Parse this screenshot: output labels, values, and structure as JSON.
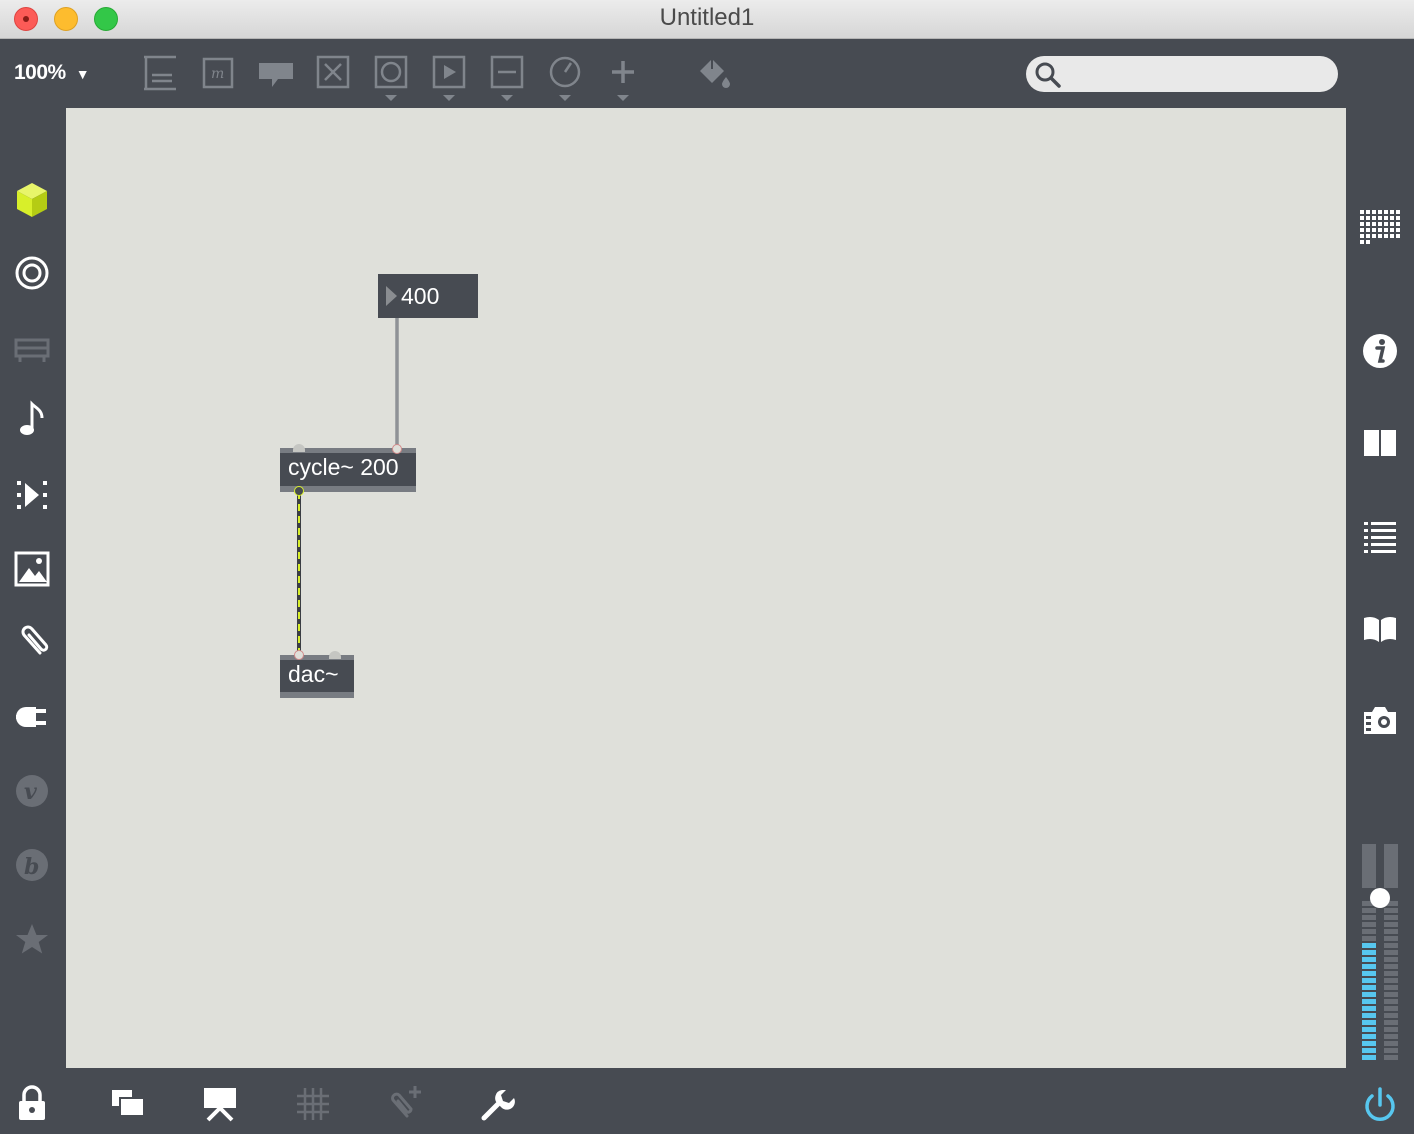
{
  "window": {
    "title": "Untitled1"
  },
  "toolbar": {
    "zoom": "100%",
    "search": {
      "value": "",
      "placeholder": ""
    }
  },
  "patch": {
    "message_box": {
      "text": "400"
    },
    "cycle_object": {
      "text": "cycle~ 200"
    },
    "dac_object": {
      "text": "dac~"
    }
  },
  "audio_meter": {
    "level": 0.74
  },
  "colors": {
    "window_chrome": "#474b52",
    "canvas": "#dfe0da",
    "accent_cube": "#d8ef2a",
    "signal_cord": "#d8ef2a",
    "meter_blue": "#57c7ef"
  }
}
